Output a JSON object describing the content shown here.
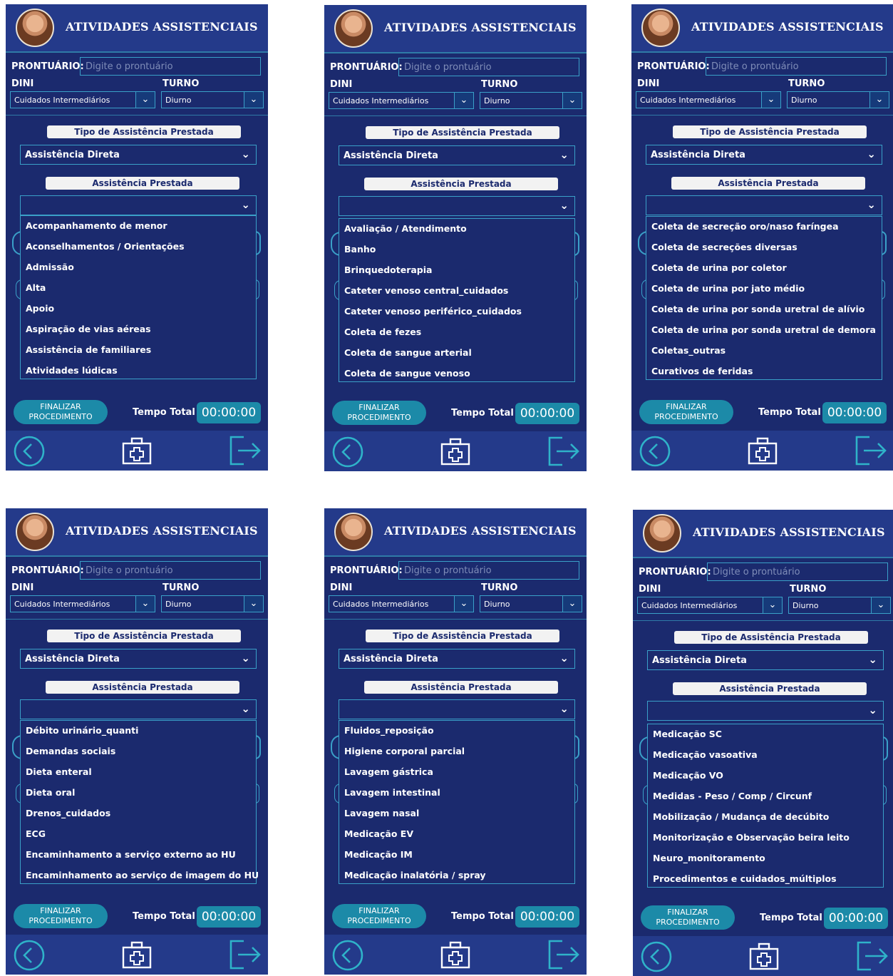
{
  "common": {
    "title": "ATIVIDADES ASSISTENCIAIS",
    "prontuario_label": "PRONTUÁRIO:",
    "prontuario_placeholder": "Digite o prontuário",
    "dini_label": "DINI",
    "dini_value": "Cuidados Intermediários",
    "turno_label": "TURNO",
    "turno_value": "Diurno",
    "tipo_label": "Tipo de Assistência Prestada",
    "tipo_value": "Assistência Direta",
    "assist_label": "Assistência Prestada",
    "assist_value": "",
    "finalizar_label": "FINALIZAR PROCEDIMENTO",
    "tempo_label": "Tempo Total",
    "tempo_value": "00:00:00",
    "icons": {
      "back": "back-circle-icon",
      "medkit": "medical-kit-icon",
      "logout": "logout-icon",
      "chevron": "chevron-down-icon"
    },
    "colors": {
      "background": "#1b2a6e",
      "header": "#243a8a",
      "accent": "#1c8aa8",
      "border": "#3aa0c8"
    }
  },
  "screens": [
    {
      "items": [
        "Acompanhamento de menor",
        "Aconselhamentos / Orientações",
        "Admissão",
        "Alta",
        "Apoio",
        "Aspiração de vias aéreas",
        "Assistência de familiares",
        "Atividades lúdicas"
      ]
    },
    {
      "items": [
        "Avaliação / Atendimento",
        "Banho",
        "Brinquedoterapia",
        "Cateter venoso central_cuidados",
        "Cateter venoso periférico_cuidados",
        "Coleta de fezes",
        "Coleta de sangue arterial",
        "Coleta de sangue venoso"
      ]
    },
    {
      "items": [
        "Coleta de secreção oro/naso faríngea",
        "Coleta de secreções diversas",
        "Coleta de urina por coletor",
        "Coleta de urina por jato médio",
        "Coleta de urina por sonda uretral de alívio",
        "Coleta de urina por sonda uretral de demora",
        "Coletas_outras",
        "Curativos de feridas"
      ]
    },
    {
      "items": [
        "Débito urinário_quanti",
        "Demandas sociais",
        "Dieta enteral",
        "Dieta oral",
        "Drenos_cuidados",
        "ECG",
        "Encaminhamento a serviço externo ao HU",
        "Encaminhamento ao serviço de imagem do HU"
      ]
    },
    {
      "items": [
        "Fluidos_reposição",
        "Higiene corporal parcial",
        "Lavagem gástrica",
        "Lavagem intestinal",
        "Lavagem nasal",
        "Medicação EV",
        "Medicação IM",
        "Medicação inalatória / spray"
      ]
    },
    {
      "items": [
        "Medicação SC",
        "Medicação vasoativa",
        "Medicação VO",
        "Medidas - Peso / Comp / Circunf",
        "Mobilização / Mudança de decúbito",
        "Monitorização e Observação beira leito",
        "Neuro_monitoramento",
        "Procedimentos e cuidados_múltiplos"
      ]
    }
  ]
}
